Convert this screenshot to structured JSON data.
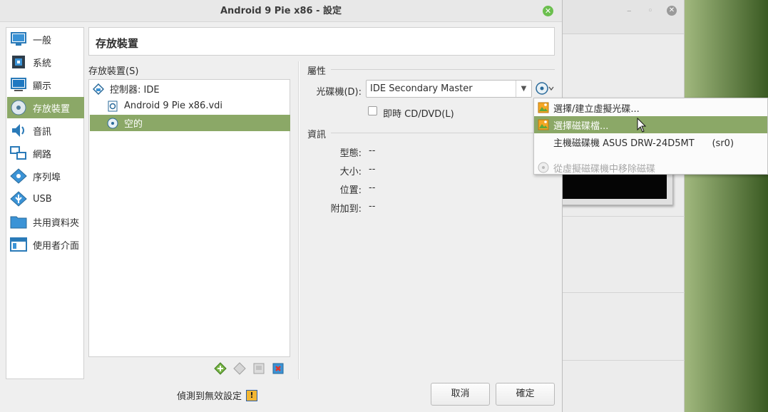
{
  "window": {
    "title": "Android 9 Pie x86 - 設定",
    "close_icon": "✕"
  },
  "background_window": {
    "minimize": "–",
    "maximize": "◦",
    "close": "✕"
  },
  "sidebar": {
    "items": [
      {
        "label": "一般",
        "icon": "monitor-icon"
      },
      {
        "label": "系統",
        "icon": "chip-icon"
      },
      {
        "label": "顯示",
        "icon": "display-icon"
      },
      {
        "label": "存放裝置",
        "icon": "storage-icon",
        "active": true
      },
      {
        "label": "音訊",
        "icon": "speaker-icon"
      },
      {
        "label": "網路",
        "icon": "network-icon"
      },
      {
        "label": "序列埠",
        "icon": "serial-icon"
      },
      {
        "label": "USB",
        "icon": "usb-icon"
      },
      {
        "label": "共用資料夾",
        "icon": "folder-icon"
      },
      {
        "label": "使用者介面",
        "icon": "ui-icon"
      }
    ]
  },
  "page": {
    "title": "存放裝置"
  },
  "storage": {
    "tree_label": "存放裝置(S)",
    "tree": [
      {
        "label": "控制器: IDE",
        "icon": "controller-icon"
      },
      {
        "label": "Android 9 Pie x86.vdi",
        "icon": "hard-disk-icon"
      },
      {
        "label": "空的",
        "icon": "optical-disc-icon",
        "selected": true
      }
    ]
  },
  "attributes": {
    "section_title": "屬性",
    "optical_drive_label": "光碟機(D):",
    "optical_drive_value": "IDE Secondary Master",
    "live_cd_label": "即時 CD/DVD(L)",
    "live_cd_checked": false
  },
  "info": {
    "section_title": "資訊",
    "rows": [
      {
        "label": "型態:",
        "value": "--"
      },
      {
        "label": "大小:",
        "value": "--"
      },
      {
        "label": "位置:",
        "value": "--"
      },
      {
        "label": "附加到:",
        "value": "--"
      }
    ]
  },
  "menu": {
    "items": [
      {
        "label": "選擇/建立虛擬光碟...",
        "icon": "choose-disk-icon"
      },
      {
        "label": "選擇磁碟檔...",
        "icon": "disk-file-icon",
        "hover": true
      },
      {
        "label": "主機磁碟機 ASUS DRW-24D5MT      (sr0)",
        "icon": ""
      },
      {
        "label": "從虛擬磁碟機中移除磁碟",
        "icon": "remove-disk-icon",
        "disabled": true
      }
    ]
  },
  "footer": {
    "warning": "偵測到無效設定",
    "cancel": "取消",
    "ok": "確定"
  },
  "colors": {
    "accent": "#8ba867",
    "dialog_bg": "#efefef"
  }
}
